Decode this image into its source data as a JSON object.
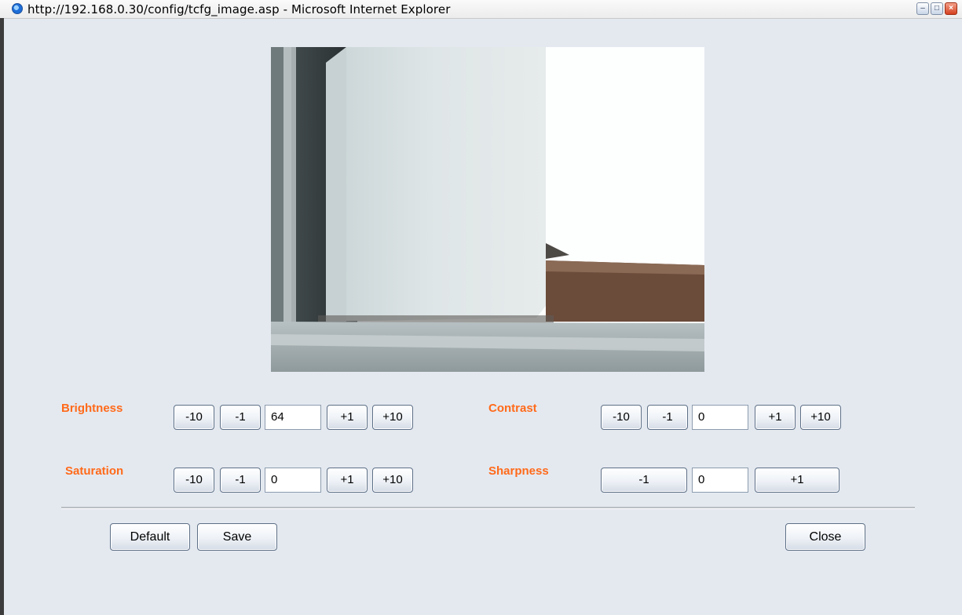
{
  "window": {
    "title": "http://192.168.0.30/config/tcfg_image.asp - Microsoft Internet Explorer",
    "icons": [
      "ie-icon",
      "minimize-icon",
      "maximize-icon",
      "close-icon"
    ]
  },
  "camera": {
    "description_icon": "camera-preview-image"
  },
  "brightness": {
    "label": "Brightness",
    "minus10": "-10",
    "minus1": "-1",
    "value": "64",
    "plus1": "+1",
    "plus10": "+10"
  },
  "contrast": {
    "label": "Contrast",
    "minus10": "-10",
    "minus1": "-1",
    "value": "0",
    "plus1": "+1",
    "plus10": "+10"
  },
  "saturation": {
    "label": "Saturation",
    "minus10": "-10",
    "minus1": "-1",
    "value": "0",
    "plus1": "+1",
    "plus10": "+10"
  },
  "sharpness": {
    "label": "Sharpness",
    "minus1": "-1",
    "value": "0",
    "plus1": "+1"
  },
  "actions": {
    "default": "Default",
    "save": "Save",
    "close": "Close"
  },
  "colors": {
    "label_accent": "#ff6a1a",
    "background": "#e4e9f0"
  }
}
